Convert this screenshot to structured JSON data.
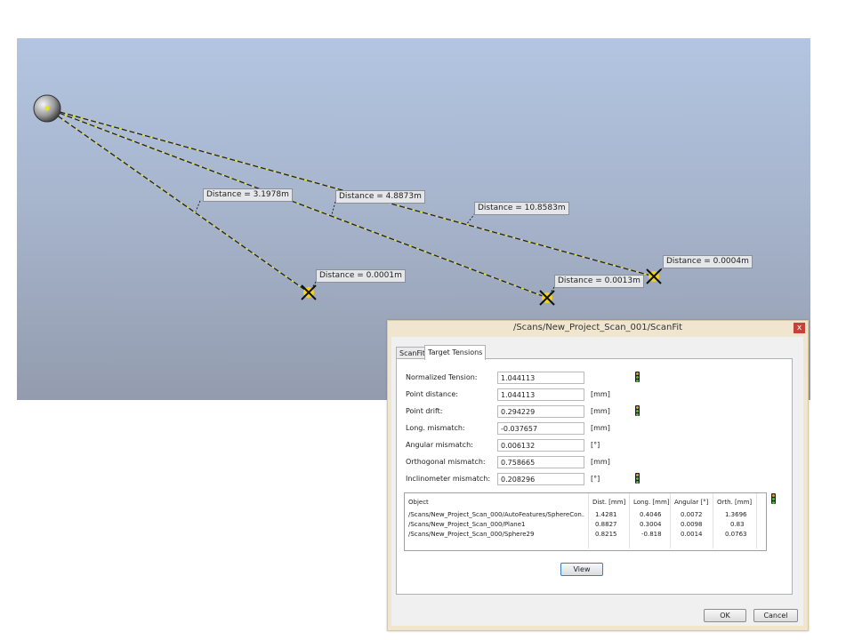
{
  "viewport": {
    "distance_labels": [
      {
        "text": "Distance = 3.1978m"
      },
      {
        "text": "Distance = 4.8873m"
      },
      {
        "text": "Distance = 10.8583m"
      },
      {
        "text": "Distance = 0.0001m"
      },
      {
        "text": "Distance = 0.0013m"
      },
      {
        "text": "Distance = 0.0004m"
      }
    ],
    "colors": {
      "line": "#e4e23a",
      "sky_top": "#b3c5e2",
      "sky_bottom": "#939cae",
      "target": "#f2d21e"
    }
  },
  "dialog": {
    "title": "/Scans/New_Project_Scan_001/ScanFit",
    "close_glyph": "x",
    "tabs": [
      "ScanFit",
      "Target Tensions"
    ],
    "active_tab": "Target Tensions",
    "fields": [
      {
        "label": "Normalized Tension:",
        "value": "1.044113",
        "unit": "",
        "indicator": true
      },
      {
        "label": "Point distance:",
        "value": "1.044113",
        "unit": "[mm]",
        "indicator": false
      },
      {
        "label": "Point drift:",
        "value": "0.294229",
        "unit": "[mm]",
        "indicator": true
      },
      {
        "label": "Long. mismatch:",
        "value": "-0.037657",
        "unit": "[mm]",
        "indicator": false
      },
      {
        "label": "Angular mismatch:",
        "value": "0.006132",
        "unit": "[°]",
        "indicator": false
      },
      {
        "label": "Orthogonal mismatch:",
        "value": "0.758665",
        "unit": "[mm]",
        "indicator": false
      },
      {
        "label": "Inclinometer mismatch:",
        "value": "0.208296",
        "unit": "[°]",
        "indicator": true
      }
    ],
    "table": {
      "columns": [
        "Object",
        "Dist. [mm]",
        "Long. [mm]",
        "Angular [°]",
        "Orth. [mm]"
      ],
      "rows": [
        [
          "/Scans/New_Project_Scan_000/AutoFeatures/SphereCon...",
          "1.4281",
          "0.4046",
          "0.0072",
          "1.3696"
        ],
        [
          "/Scans/New_Project_Scan_000/Plane1",
          "0.8827",
          "0.3004",
          "0.0098",
          "0.83"
        ],
        [
          "/Scans/New_Project_Scan_000/Sphere29",
          "0.8215",
          "-0.818",
          "0.0014",
          "0.0763"
        ]
      ]
    },
    "view_button": "View",
    "ok_button": "OK",
    "cancel_button": "Cancel",
    "indicator_colors": {
      "red": "#d63a2c",
      "amber": "#e0a62a",
      "green": "#4fbf3a"
    }
  }
}
